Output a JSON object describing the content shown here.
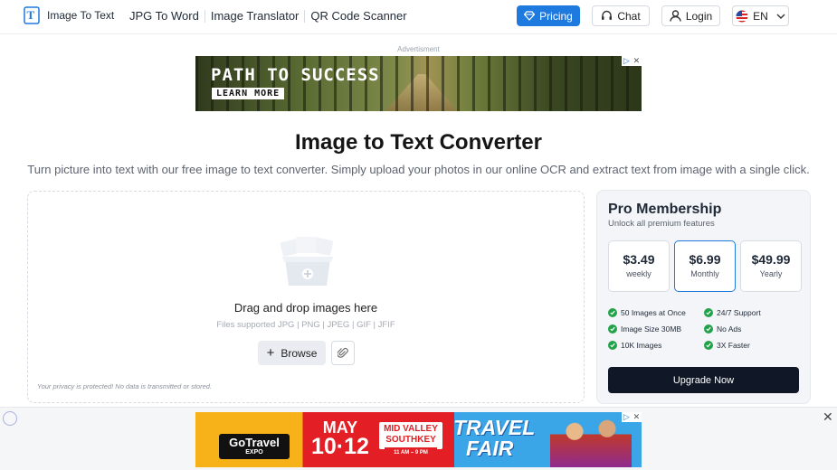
{
  "header": {
    "logo_text": "Image To Text",
    "nav": [
      "JPG To Word",
      "Image Translator",
      "QR Code Scanner"
    ],
    "pricing_label": "Pricing",
    "chat_label": "Chat",
    "login_label": "Login",
    "language": "EN"
  },
  "ad_top": {
    "label": "Advertisment",
    "headline": "PATH TO SUCCESS",
    "cta": "LEARN MORE"
  },
  "main": {
    "title": "Image to Text Converter",
    "subtitle": "Turn picture into text with our free image to text converter. Simply upload your photos in our online OCR and extract text from image with a single click."
  },
  "upload": {
    "title": "Drag and drop images here",
    "types": "Files supported JPG | PNG | JPEG | GIF | JFIF",
    "browse_label": "Browse",
    "privacy": "Your privacy is protected! No data is transmitted or stored."
  },
  "pro": {
    "title": "Pro Membership",
    "subtitle": "Unlock all premium features",
    "plans": [
      {
        "price": "$3.49",
        "period": "weekly"
      },
      {
        "price": "$6.99",
        "period": "Monthly"
      },
      {
        "price": "$49.99",
        "period": "Yearly"
      }
    ],
    "selected_plan": "Monthly",
    "features": [
      "50 Images at Once",
      "24/7 Support",
      "Image Size 30MB",
      "No Ads",
      "10K Images",
      "3X Faster"
    ],
    "upgrade_label": "Upgrade Now"
  },
  "ad_bottom": {
    "brand": "GoTravel",
    "brand_sub": "EXPO",
    "month": "MAY",
    "dates": "10·12",
    "venue": "MID VALLEY SOUTHKEY",
    "hours": "11 AM – 9 PM",
    "travel": "TRAVEL",
    "fair": "FAIR"
  },
  "colors": {
    "accent": "#1f7ae0",
    "upgrade_button": "#101828",
    "check": "#22a34a"
  },
  "icons": [
    "logo-icon",
    "diamond-icon",
    "headset-icon",
    "user-icon",
    "us-flag-icon",
    "chevron-down-icon",
    "upload-illustration",
    "plus-icon",
    "paperclip-icon",
    "check-icon",
    "close-icon",
    "ad-choices-icon"
  ]
}
